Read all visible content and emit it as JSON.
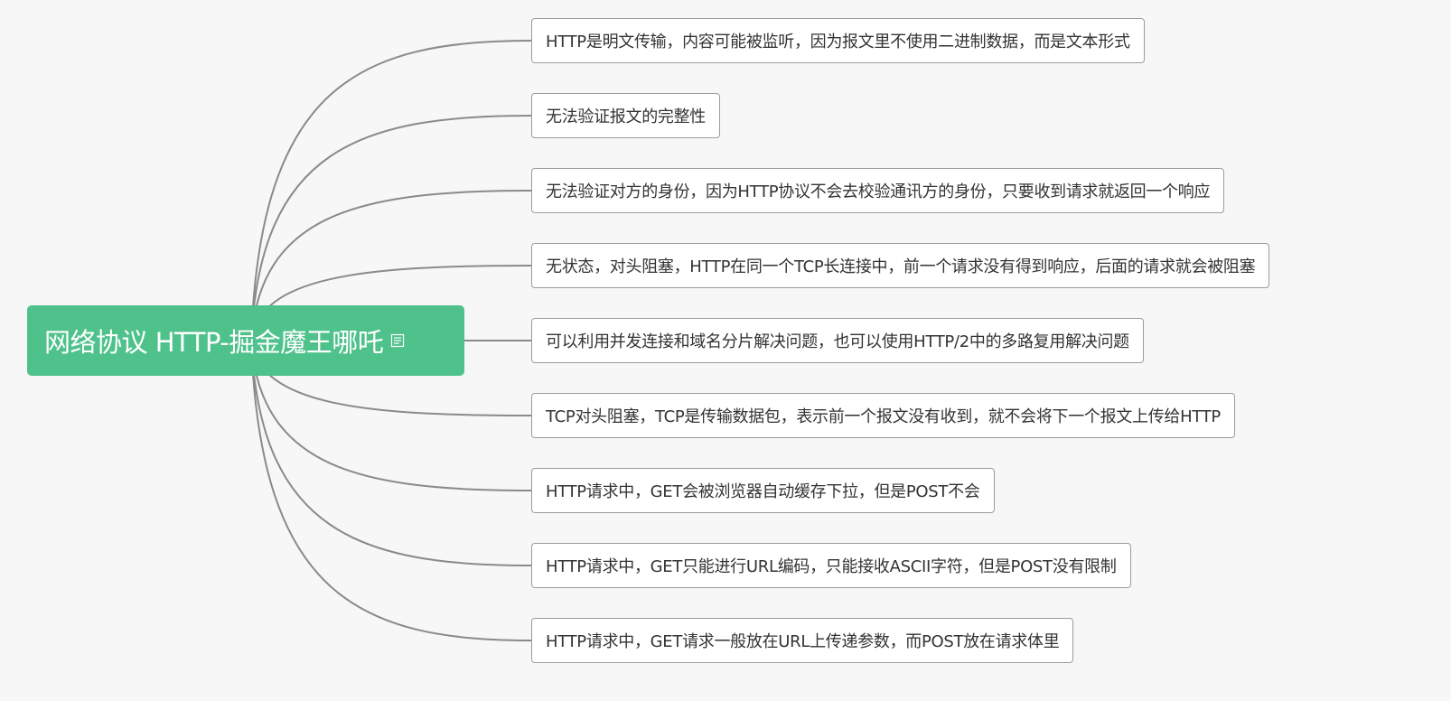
{
  "root": {
    "title": "网络协议 HTTP-掘金魔王哪吒",
    "has_note_icon": true
  },
  "colors": {
    "background": "#f7f7f7",
    "root_fill": "#4fc28c",
    "connector": "#8a8a8a",
    "node_border": "#9c9c9c"
  },
  "children": [
    {
      "label": "HTTP是明文传输，内容可能被监听，因为报文里不使用二进制数据，而是文本形式"
    },
    {
      "label": "无法验证报文的完整性"
    },
    {
      "label": "无法验证对方的身份，因为HTTP协议不会去校验通讯方的身份，只要收到请求就返回一个响应"
    },
    {
      "label": "无状态，对头阻塞，HTTP在同一个TCP长连接中，前一个请求没有得到响应，后面的请求就会被阻塞"
    },
    {
      "label": "可以利用并发连接和域名分片解决问题，也可以使用HTTP/2中的多路复用解决问题"
    },
    {
      "label": "TCP对头阻塞，TCP是传输数据包，表示前一个报文没有收到，就不会将下一个报文上传给HTTP"
    },
    {
      "label": "HTTP请求中，GET会被浏览器自动缓存下拉，但是POST不会"
    },
    {
      "label": "HTTP请求中，GET只能进行URL编码，只能接收ASCII字符，但是POST没有限制"
    },
    {
      "label": "HTTP请求中，GET请求一般放在URL上传递参数，而POST放在请求体里"
    }
  ]
}
